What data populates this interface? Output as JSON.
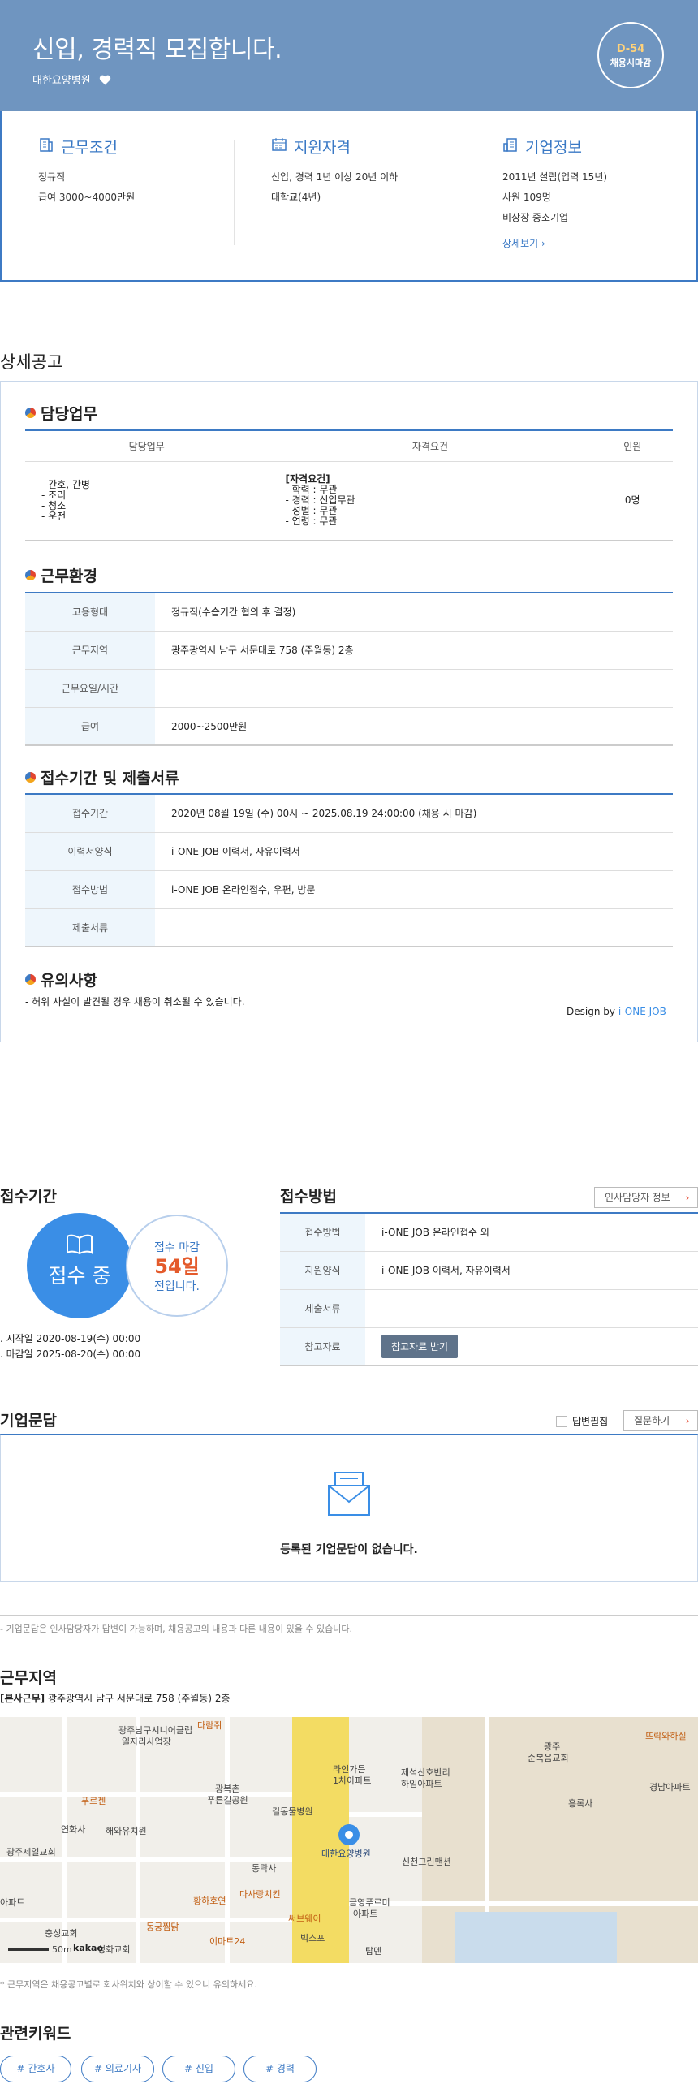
{
  "header": {
    "title": "신입, 경력직 모집합니다.",
    "company": "대한요양병원",
    "dday": "D-54",
    "closed_label": "채용시마감"
  },
  "summary": {
    "conditions": {
      "title": "근무조건",
      "lines": [
        "정규직",
        "급여 3000~4000만원"
      ]
    },
    "qualifications": {
      "title": "지원자격",
      "lines": [
        "신입, 경력 1년 이상 20년 이하",
        "대학교(4년)"
      ]
    },
    "company_info": {
      "title": "기업정보",
      "lines": [
        "2011년 설립(업력 15년)",
        "사원 109명",
        "비상장 중소기업"
      ],
      "more": "상세보기"
    }
  },
  "detail": {
    "title": "상세공고",
    "duties": {
      "title": "담당업무",
      "headers": [
        "담당업무",
        "자격요건",
        "인원"
      ],
      "duties_lines": [
        "- 간호, 간병",
        "- 조리",
        "- 청소",
        "- 운전"
      ],
      "req_head": "[자격요건]",
      "req_lines": [
        "- 학력 : 무관",
        "- 경력 : 신입무관",
        "- 성별 : 무관",
        "- 연령 : 무관"
      ],
      "count": "0명"
    },
    "environment": {
      "title": "근무환경",
      "rows": [
        {
          "label": "고용형태",
          "value": "정규직(수습기간 협의 후 결정)"
        },
        {
          "label": "근무지역",
          "value": "광주광역시 남구 서문대로 758 (주월동) 2층"
        },
        {
          "label": "근무요일/시간",
          "value": ""
        },
        {
          "label": "급여",
          "value": "2000~2500만원"
        }
      ]
    },
    "docs": {
      "title": "접수기간 및 제출서류",
      "rows": [
        {
          "label": "접수기간",
          "value": "2020년 08월 19일 (수) 00시 ~ 2025.08.19 24:00:00 (채용 시 마감)"
        },
        {
          "label": "이력서양식",
          "value": "i-ONE JOB 이력서, 자유이력서"
        },
        {
          "label": "접수방법",
          "value": "i-ONE JOB 온라인접수, 우편, 방문"
        },
        {
          "label": "제출서류",
          "value": ""
        }
      ]
    },
    "notice": {
      "title": "유의사항",
      "text": "- 허위 사실이 발견될 경우 채용이 취소될 수 있습니다."
    },
    "design_prefix": "- Design by ",
    "design_brand": "i-ONE JOB -"
  },
  "apply": {
    "period_title": "접수기간",
    "status": "접수 중",
    "deadline_label": "접수 마감",
    "days_left": "54일",
    "days_suffix": "전입니다.",
    "start": "시작일 2020-08-19(수) 00:00",
    "end": "마감일 2025-08-20(수) 00:00",
    "method_title": "접수방법",
    "hr_button": "인사담당자 정보",
    "rows": [
      {
        "label": "접수방법",
        "value": "i-ONE JOB 온라인접수 외"
      },
      {
        "label": "지원양식",
        "value": "i-ONE JOB 이력서, 자유이력서"
      },
      {
        "label": "제출서류",
        "value": ""
      },
      {
        "label": "참고자료",
        "value": ""
      }
    ],
    "ref_button": "참고자료 받기"
  },
  "qa": {
    "title": "기업문답",
    "answered_label": "답변필칩",
    "ask_button": "질문하기",
    "empty": "등록된 기업문답이 없습니다.",
    "note": "- 기업문답은 인사담당자가 답변이 가능하며, 채용공고의 내용과 다른 내용이 있을 수 있습니다."
  },
  "location": {
    "title": "근무지역",
    "tag": "[본사근무]",
    "address": "광주광역시 남구 서문대로 758 (주월동) 2층",
    "map_labels": [
      "광주남구시니어클럽",
      "일자리사업장",
      "다람쥐",
      "광복촌",
      "푸른길공원",
      "길동물병원",
      "라인가든",
      "1차아파트",
      "제석산호반리",
      "하임아파트",
      "광주",
      "순복음교회",
      "뜨락와하실",
      "경남아파트",
      "흥록사",
      "푸르젠",
      "연화사",
      "해와유치원",
      "광주제일교회",
      "대한요양병원",
      "신천그린맨션",
      "동락사",
      "황하호연",
      "다사랑치킨",
      "써브웨이",
      "금영푸르미",
      "아파트",
      "충성교회",
      "성화교회",
      "동궁찜닭",
      "이마트24",
      "빅스포",
      "탑덴",
      "아파트"
    ],
    "map_scale": "50m",
    "map_brand": "kakao",
    "note": "* 근무지역은 채용공고별로 회사위치와 상이할 수 있으니 유의하세요."
  },
  "keywords": {
    "title": "관련키워드",
    "items": [
      "# 간호사",
      "# 의료기사",
      "# 신입",
      "# 경력"
    ]
  }
}
